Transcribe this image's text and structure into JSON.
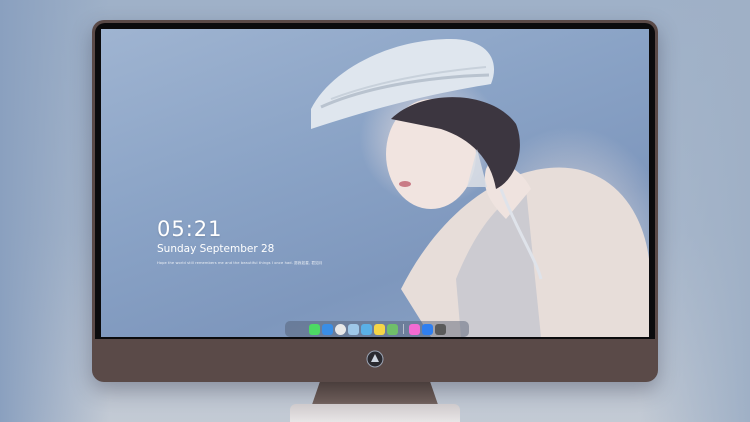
{
  "lock_screen": {
    "time": "05:21",
    "date": "Sunday September  28",
    "motto": "Hope the world still remembers me and the beautiful things I once had. 愿我如星, 君如月"
  },
  "dock": {
    "apps": [
      {
        "name": "messages-icon",
        "color": "#4cd964"
      },
      {
        "name": "finder-icon",
        "color": "#3a8ee6"
      },
      {
        "name": "clock-icon",
        "color": "#e8e8e8"
      },
      {
        "name": "preview-icon",
        "color": "#9ec7e8"
      },
      {
        "name": "files-icon",
        "color": "#5ab0e6"
      },
      {
        "name": "notes-icon",
        "color": "#f5d547"
      },
      {
        "name": "photos-icon",
        "color": "#6fbf6a"
      },
      {
        "name": "music-icon",
        "color": "#f26bd2"
      },
      {
        "name": "app-store-icon",
        "color": "#2f7ff0"
      },
      {
        "name": "camera-icon",
        "color": "#5a5a5a"
      }
    ]
  },
  "colors": {
    "monitor_body": "#5a4a48",
    "bezel": "#0b0b0d",
    "screen_bg": "#8aa3c6"
  }
}
